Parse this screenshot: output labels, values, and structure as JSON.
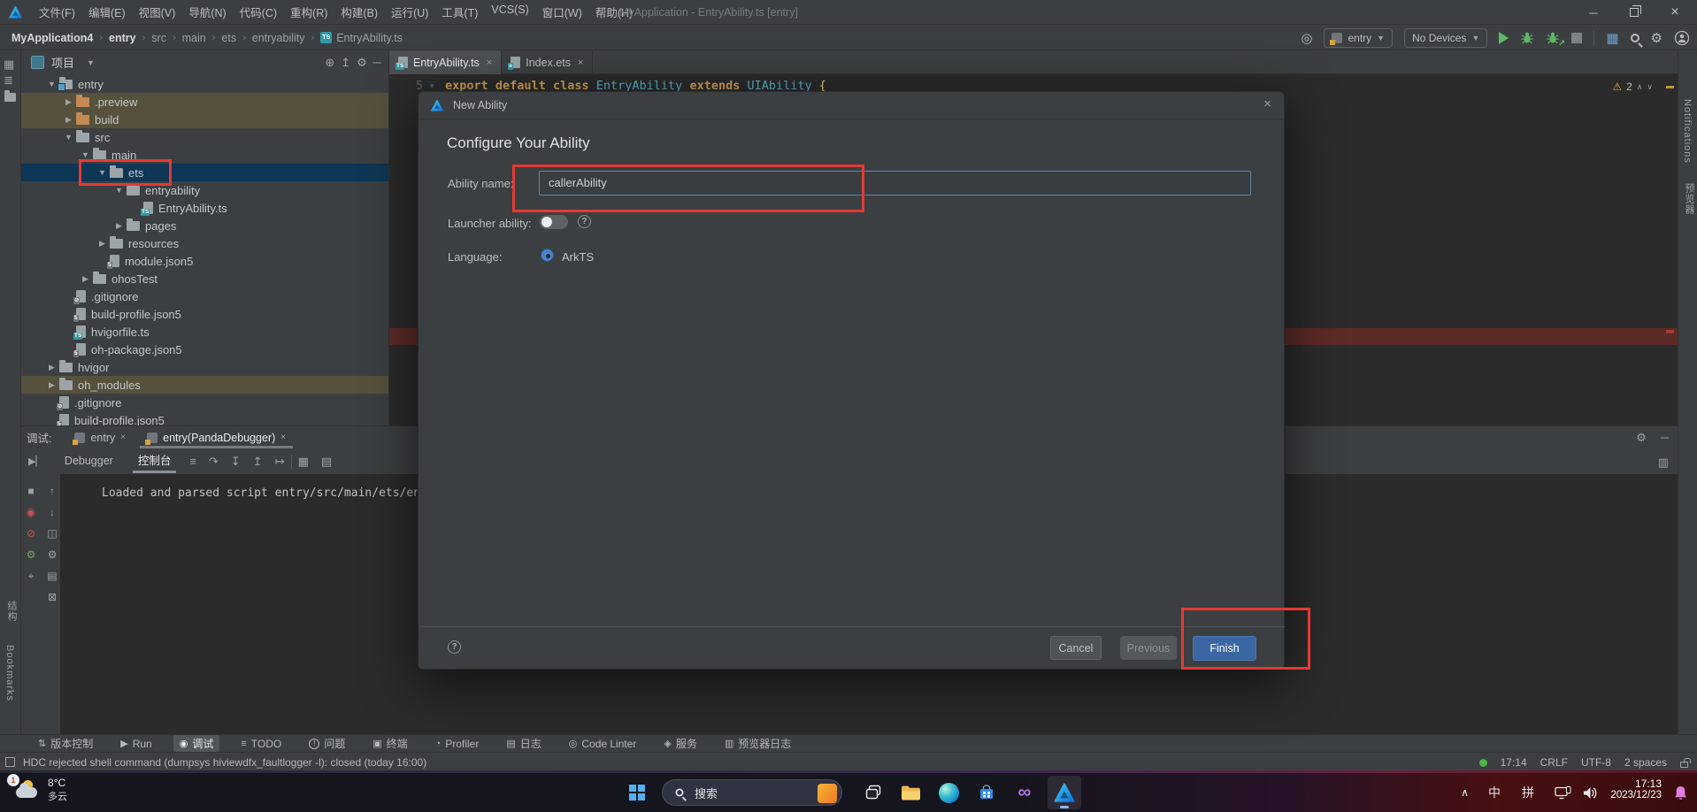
{
  "window": {
    "title": "MyApplication - EntryAbility.ts [entry]",
    "menus": [
      "文件(F)",
      "编辑(E)",
      "视图(V)",
      "导航(N)",
      "代码(C)",
      "重构(R)",
      "构建(B)",
      "运行(U)",
      "工具(T)",
      "VCS(S)",
      "窗口(W)",
      "帮助(H)"
    ]
  },
  "breadcrumb": [
    "MyApplication4",
    "entry",
    "src",
    "main",
    "ets",
    "entryability",
    "EntryAbility.ts"
  ],
  "toolbar": {
    "run_config": "entry",
    "device": "No Devices"
  },
  "left_stripe": {
    "structure": "结构",
    "bookmarks": "Bookmarks"
  },
  "project": {
    "title": "项目",
    "tree": [
      {
        "label": "entry",
        "level": 0,
        "state": "expanded",
        "icon": "folder-module"
      },
      {
        "label": ".preview",
        "level": 1,
        "state": "collapsed",
        "icon": "folder-excluded",
        "excluded": true
      },
      {
        "label": "build",
        "level": 1,
        "state": "collapsed",
        "icon": "folder-excluded",
        "excluded": true
      },
      {
        "label": "src",
        "level": 1,
        "state": "expanded",
        "icon": "folder"
      },
      {
        "label": "main",
        "level": 2,
        "state": "expanded",
        "icon": "folder"
      },
      {
        "label": "ets",
        "level": 3,
        "state": "expanded",
        "icon": "folder",
        "selected": true
      },
      {
        "label": "entryability",
        "level": 4,
        "state": "expanded",
        "icon": "folder"
      },
      {
        "label": "EntryAbility.ts",
        "level": 5,
        "state": "none",
        "icon": "file-ts"
      },
      {
        "label": "pages",
        "level": 4,
        "state": "collapsed",
        "icon": "folder"
      },
      {
        "label": "resources",
        "level": 3,
        "state": "collapsed",
        "icon": "folder"
      },
      {
        "label": "module.json5",
        "level": 3,
        "state": "none",
        "icon": "file-json5"
      },
      {
        "label": "ohosTest",
        "level": 2,
        "state": "collapsed",
        "icon": "folder"
      },
      {
        "label": ".gitignore",
        "level": 1,
        "state": "none",
        "icon": "file-git"
      },
      {
        "label": "build-profile.json5",
        "level": 1,
        "state": "none",
        "icon": "file-json5"
      },
      {
        "label": "hvigorfile.ts",
        "level": 1,
        "state": "none",
        "icon": "file-ts"
      },
      {
        "label": "oh-package.json5",
        "level": 1,
        "state": "none",
        "icon": "file-json5"
      },
      {
        "label": "hvigor",
        "level": 0,
        "state": "collapsed",
        "icon": "folder"
      },
      {
        "label": "oh_modules",
        "level": 0,
        "state": "collapsed",
        "icon": "folder",
        "excluded": true
      },
      {
        "label": ".gitignore",
        "level": 0,
        "state": "none",
        "icon": "file-git"
      },
      {
        "label": "build-profile.json5",
        "level": 0,
        "state": "none",
        "icon": "file-json5"
      }
    ]
  },
  "editor": {
    "tabs": [
      {
        "label": "EntryAbility.ts",
        "badge": "TS",
        "active": true
      },
      {
        "label": "Index.ets",
        "badge": "e",
        "active": false
      }
    ],
    "line_number": "5",
    "code": [
      {
        "t": "export",
        "c": "kw"
      },
      {
        "t": " ",
        "c": "pl"
      },
      {
        "t": "default",
        "c": "kw"
      },
      {
        "t": " ",
        "c": "pl"
      },
      {
        "t": "class",
        "c": "kw"
      },
      {
        "t": " ",
        "c": "pl"
      },
      {
        "t": "EntryAbility",
        "c": "cls"
      },
      {
        "t": " ",
        "c": "pl"
      },
      {
        "t": "extends",
        "c": "kw"
      },
      {
        "t": " ",
        "c": "pl"
      },
      {
        "t": "UIAbility",
        "c": "cls"
      },
      {
        "t": " ",
        "c": "pl"
      },
      {
        "t": "{",
        "c": "br"
      }
    ],
    "warnings": "2"
  },
  "right_stripe": {
    "notifications": "Notifications",
    "previewer": "预览器"
  },
  "dialog": {
    "title": "New Ability",
    "heading": "Configure Your Ability",
    "ability_name_label": "Ability name:",
    "ability_name_value": "callerAbility",
    "launcher_label": "Launcher ability:",
    "language_label": "Language:",
    "language_value": "ArkTS",
    "cancel": "Cancel",
    "previous": "Previous",
    "finish": "Finish"
  },
  "debug": {
    "label": "调试:",
    "sessions": [
      {
        "label": "entry",
        "active": false
      },
      {
        "label": "entry(PandaDebugger)",
        "active": true
      }
    ],
    "views": [
      {
        "label": "Debugger",
        "active": false
      },
      {
        "label": "控制台",
        "active": true
      }
    ],
    "console": "Loaded and parsed script entry/src/main/ets/ent"
  },
  "bottom_bar": [
    {
      "name": "version-control",
      "glyph": "⇅",
      "label": "版本控制"
    },
    {
      "name": "run",
      "glyph": "▶",
      "label": "Run"
    },
    {
      "name": "debug",
      "glyph": "◉",
      "label": "调试",
      "active": true
    },
    {
      "name": "todo",
      "glyph": "≡",
      "label": "TODO"
    },
    {
      "name": "problems",
      "glyph": "!",
      "label": "问题",
      "circle": true
    },
    {
      "name": "terminal",
      "glyph": "▣",
      "label": "终端"
    },
    {
      "name": "profiler",
      "glyph": "◔",
      "label": "Profiler"
    },
    {
      "name": "logs",
      "glyph": "▤",
      "label": "日志"
    },
    {
      "name": "code-linter",
      "glyph": "◎",
      "label": "Code Linter"
    },
    {
      "name": "services",
      "glyph": "◈",
      "label": "服务"
    },
    {
      "name": "previewer-log",
      "glyph": "▥",
      "label": "预览器日志"
    }
  ],
  "status": {
    "message": "HDC rejected shell command (dumpsys hiviewdfx_faultlogger -l): closed (today 16:00)",
    "time": "17:14",
    "line_sep": "CRLF",
    "encoding": "UTF-8",
    "indent": "2 spaces"
  },
  "taskbar": {
    "weather_temp": "8°C",
    "weather_cond": "多云",
    "weather_badge": "1",
    "search": "搜索",
    "ime1": "中",
    "ime2": "拼",
    "clock_time": "17:13",
    "clock_date": "2023/12/23"
  },
  "icons": {
    "locate-icon": "◎",
    "gear-icon": "⚙",
    "warning-icon": "⚠",
    "collapse-all-icon": "↥",
    "hide-panel-icon": "─",
    "step-over-icon": "↷",
    "step-into-icon": "↧",
    "step-out-icon": "↥",
    "run-to-cursor-icon": "↦",
    "evaluate-icon": "▦",
    "layout-icon": "▤",
    "menu-icon": "≡"
  },
  "colors": {
    "annotation_red": "#e53935",
    "finish_blue": "#3a67a3",
    "selection_blue": "#0e3655",
    "excluded_tan": "#55513c",
    "status_green": "#4db545"
  }
}
